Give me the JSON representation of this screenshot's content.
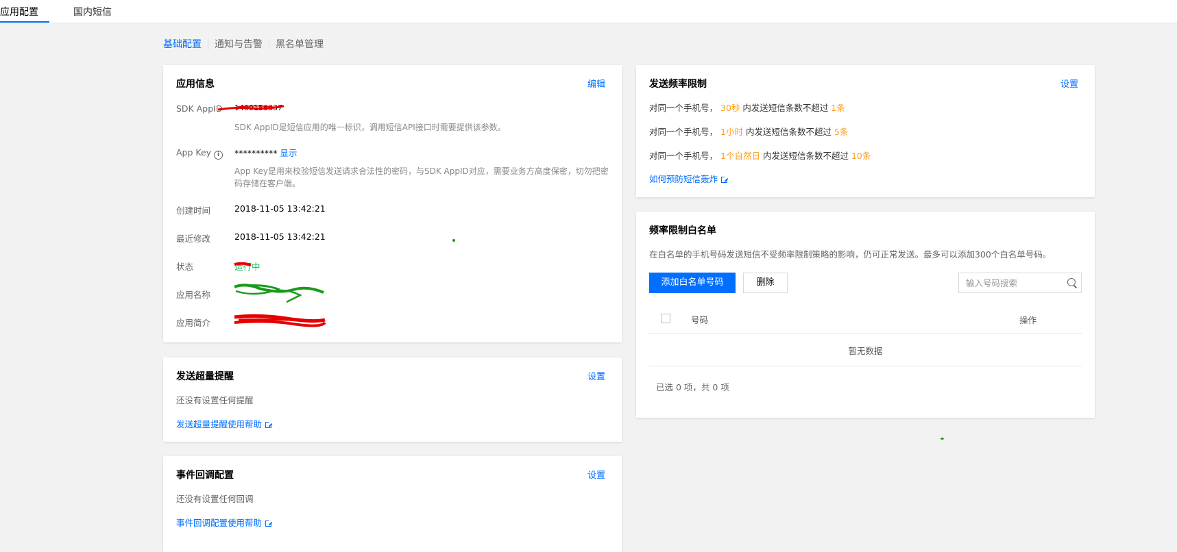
{
  "top_tabs": [
    {
      "label": "应用配置",
      "active": true
    },
    {
      "label": "国内短信",
      "active": false
    }
  ],
  "sub_tabs": [
    "基础配置",
    "通知与告警",
    "黑名单管理"
  ],
  "app_info": {
    "title": "应用信息",
    "edit": "编辑",
    "sdk_appid_label": "SDK AppID",
    "sdk_appid_value": "1400156337",
    "sdk_appid_desc": "SDK AppID是短信应用的唯一标识，调用短信API接口时需要提供该参数。",
    "app_key_label": "App Key",
    "app_key_value": "**********",
    "app_key_show": "显示",
    "app_key_desc": "App Key是用来校验短信发送请求合法性的密码，与SDK AppID对应，需要业务方高度保密，切勿把密码存储在客户端。",
    "created_label": "创建时间",
    "created_value": "2018-11-05 13:42:21",
    "modified_label": "最近修改",
    "modified_value": "2018-11-05 13:42:21",
    "status_label": "状态",
    "status_value": "运行中",
    "name_label": "应用名称",
    "intro_label": "应用简介"
  },
  "overflow_alert": {
    "title": "发送超量提醒",
    "setting": "设置",
    "empty_text": "还没有设置任何提醒",
    "help_link": "发送超量提醒使用帮助"
  },
  "callback": {
    "title": "事件回调配置",
    "setting": "设置",
    "empty_text": "还没有设置任何回调",
    "help_link": "事件回调配置使用帮助"
  },
  "freq_limit": {
    "title": "发送频率限制",
    "setting": "设置",
    "lines": [
      {
        "prefix": "对同一个手机号，",
        "period": "30秒",
        "middle": "内发送短信条数不超过",
        "count": "1条"
      },
      {
        "prefix": "对同一个手机号，",
        "period": "1小时",
        "middle": "内发送短信条数不超过",
        "count": "5条"
      },
      {
        "prefix": "对同一个手机号，",
        "period": "1个自然日",
        "middle": "内发送短信条数不超过",
        "count": "10条"
      }
    ],
    "help_link": "如何预防短信轰炸"
  },
  "whitelist": {
    "title": "频率限制白名单",
    "desc": "在白名单的手机号码发送短信不受频率限制策略的影响，仍可正常发送。最多可以添加300个白名单号码。",
    "add_button": "添加白名单号码",
    "delete_button": "删除",
    "search_placeholder": "输入号码搜索",
    "col_number": "号码",
    "col_action": "操作",
    "empty": "暂无数据",
    "footer": "已选 0 项，共 0 项"
  },
  "colors": {
    "accent": "#006eff",
    "highlight": "#ff9c19",
    "status_running": "#0abf5b"
  }
}
